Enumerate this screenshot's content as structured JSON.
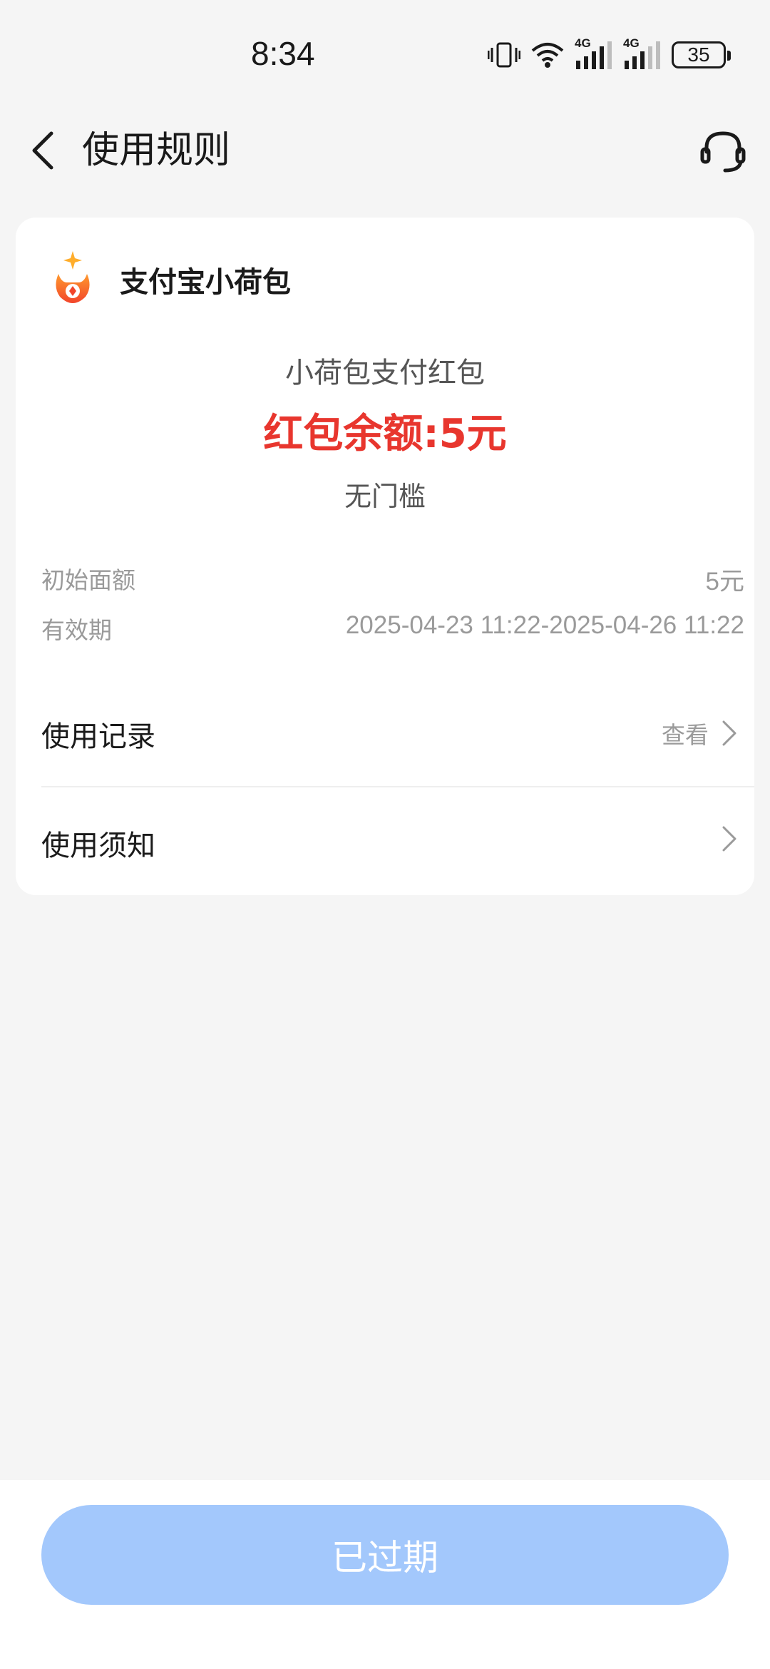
{
  "status_bar": {
    "time": "8:34",
    "battery": "35",
    "network_1": "4G",
    "network_2": "4G",
    "icons": [
      "vibrate-icon",
      "wifi-icon",
      "signal-icon",
      "signal-icon",
      "battery-icon"
    ]
  },
  "header": {
    "title": "使用规则",
    "back_icon": "chevron-left-icon",
    "service_icon": "headset-icon"
  },
  "card": {
    "brand_name": "支付宝小荷包",
    "brand_logo_icon": "xiaohebao-logo-icon",
    "coupon_name": "小荷包支付红包",
    "coupon_balance": "红包余额:5元",
    "coupon_condition": "无门槛",
    "info": [
      {
        "label": "初始面额",
        "value": "5元"
      },
      {
        "label": "有效期",
        "value": "2025-04-23 11:22-2025-04-26 11:22"
      }
    ],
    "links": [
      {
        "label": "使用记录",
        "hint": "查看"
      },
      {
        "label": "使用须知",
        "hint": ""
      }
    ]
  },
  "bottom": {
    "button_label": "已过期"
  },
  "colors": {
    "background": "#f5f5f5",
    "card": "#ffffff",
    "balance_red": "#e8362e",
    "button_disabled_blue": "#a3c8fc"
  }
}
